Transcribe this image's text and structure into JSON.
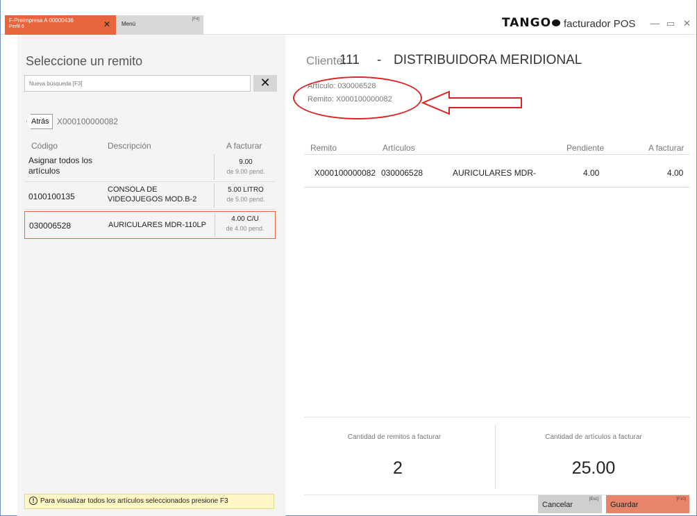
{
  "titlebar": {
    "active_tab": {
      "line1": "F-Preimpresa A 00000436",
      "line2": "Perfil 6"
    },
    "menu_tab": {
      "label": "Menú",
      "shortcut": "[F4]"
    },
    "brand": "TANGO",
    "app_name": "facturador POS"
  },
  "left_panel": {
    "title": "Seleccione un remito",
    "search": {
      "placeholder": "Nueva búsqueda [F3]",
      "value": ""
    },
    "clear_label": "✕",
    "back_label": "Atrás",
    "current_remito": "X000100000082",
    "columns": {
      "code": "Código",
      "description": "Descripción",
      "to_invoice": "A facturar"
    },
    "rows": [
      {
        "code": "Asignar todos los artículos",
        "description": "",
        "qty": "9.00",
        "pending": "de 9.00 pend."
      },
      {
        "code": "0100100135",
        "description": "CONSOLA DE VIDEOJUEGOS MOD.B-2",
        "qty": "5.00 LITRO",
        "pending": "de 5.00 pend."
      },
      {
        "code": "030006528",
        "description": "AURICULARES MDR-110LP",
        "qty": "4.00 C/U",
        "pending": "de 4.00 pend."
      }
    ],
    "hint": "Para visualizar todos los artículos seleccionados presione F3"
  },
  "client": {
    "label": "Cliente:",
    "number": "111",
    "separator": "-",
    "name": "DISTRIBUIDORA MERIDIONAL",
    "article_line": "Artículo: 030006528",
    "remito_line": "Remito:  X000100000082"
  },
  "detail_table": {
    "columns": {
      "remito": "Remito",
      "articles": "Artículos",
      "pending": "Pendiente",
      "to_invoice": "A facturar"
    },
    "rows": [
      {
        "remito": "X000100000082",
        "article_code": "030006528",
        "article_desc": "AURICULARES MDR-",
        "pending": "4.00",
        "to_invoice": "4.00"
      }
    ]
  },
  "totals": {
    "remitos_label": "Cantidad de remitos a facturar",
    "remitos_value": "2",
    "articles_label": "Cantidad de artículos a facturar",
    "articles_value": "25.00"
  },
  "footer": {
    "cancel_label": "Cancelar",
    "cancel_key": "[Esc]",
    "save_label": "Guardar",
    "save_key": "[F10]"
  },
  "colors": {
    "accent": "#e8643c",
    "annotation": "#d22222",
    "hint_bg": "#fff7c6"
  }
}
